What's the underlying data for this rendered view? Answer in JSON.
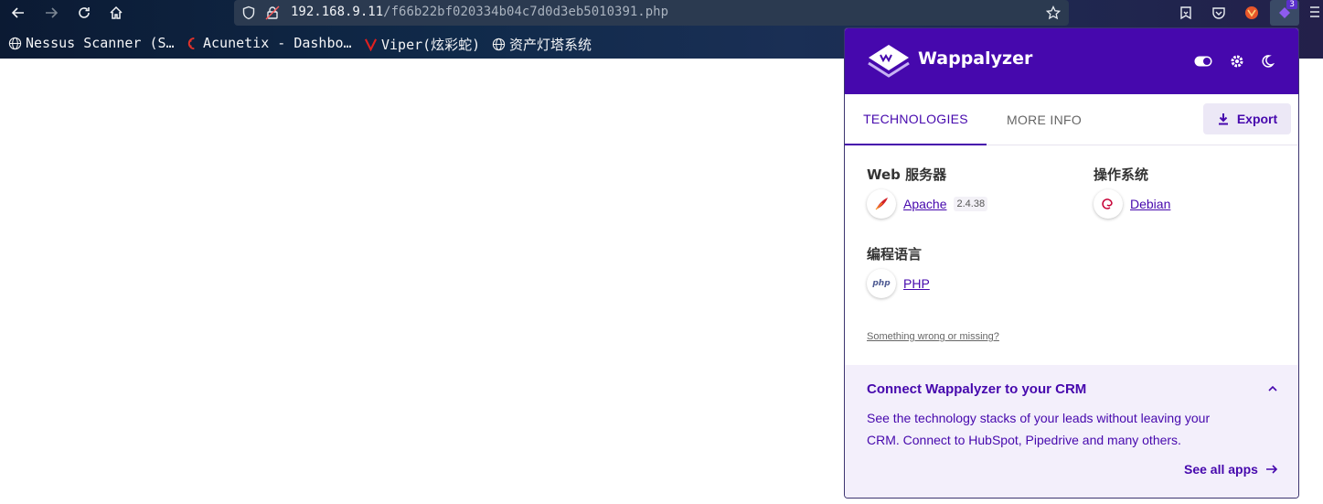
{
  "browser": {
    "url_host": "192.168.9.11",
    "url_path": "/f66b22bf020334b04c7d0d3eb5010391.php",
    "extension_badge": "3"
  },
  "bookmarks": [
    {
      "label": "Nessus Scanner (S…",
      "icon": "globe-icon"
    },
    {
      "label": "Acunetix - Dashbo…",
      "icon": "acunetix-icon"
    },
    {
      "label": "Viper(炫彩蛇)",
      "icon": "viper-icon"
    },
    {
      "label": "资产灯塔系统",
      "icon": "globe-icon"
    }
  ],
  "popup": {
    "brand": "Wappalyzer",
    "tabs": [
      {
        "label": "TECHNOLOGIES",
        "active": true
      },
      {
        "label": "MORE INFO",
        "active": false
      }
    ],
    "export_label": "Export",
    "categories": [
      {
        "name": "Web 服务器",
        "items": [
          {
            "name": "Apache",
            "version": "2.4.38",
            "icon": "apache-feather-icon"
          }
        ]
      },
      {
        "name": "操作系统",
        "items": [
          {
            "name": "Debian",
            "version": "",
            "icon": "debian-swirl-icon"
          }
        ]
      },
      {
        "name": "编程语言",
        "items": [
          {
            "name": "PHP",
            "version": "",
            "icon": "php-icon"
          }
        ]
      }
    ],
    "php_icon_text": "php",
    "wrong_link": "Something wrong or missing?",
    "crm": {
      "title": "Connect Wappalyzer to your CRM",
      "text": "See the technology stacks of your leads without leaving your CRM. Connect to HubSpot, Pipedrive and many others.",
      "link": "See all apps"
    },
    "colors": {
      "brand": "#4608ad",
      "crm_bg": "#f3effb"
    }
  }
}
